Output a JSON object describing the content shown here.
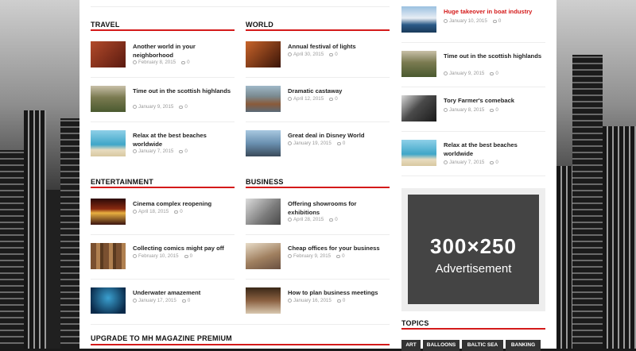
{
  "sections": {
    "travel": {
      "title": "TRAVEL",
      "items": [
        {
          "title": "Another world in your neighborhood",
          "date": "February 8, 2015",
          "comments": "0",
          "thumb_color": "#8a3320"
        },
        {
          "title": "Time out in the scottish highlands",
          "date": "January 9, 2015",
          "comments": "0",
          "thumb_color": "#5b6a3a"
        },
        {
          "title": "Relax at the best beaches worldwide",
          "date": "January 7, 2015",
          "comments": "0",
          "thumb_color": "#3f9fc0"
        }
      ]
    },
    "world": {
      "title": "WORLD",
      "items": [
        {
          "title": "Annual festival of lights",
          "date": "April 30, 2015",
          "comments": "0",
          "thumb_color": "#7a3a1a"
        },
        {
          "title": "Dramatic castaway",
          "date": "April 12, 2015",
          "comments": "0",
          "thumb_color": "#6a7f8f"
        },
        {
          "title": "Great deal in Disney World",
          "date": "January 19, 2015",
          "comments": "0",
          "thumb_color": "#5e86a8"
        }
      ]
    },
    "entertainment": {
      "title": "ENTERTAINMENT",
      "items": [
        {
          "title": "Cinema complex reopening",
          "date": "April 18, 2015",
          "comments": "0",
          "thumb_color": "#3a1410"
        },
        {
          "title": "Collecting comics might pay off",
          "date": "February 10, 2015",
          "comments": "0",
          "thumb_color": "#6b4a2a"
        },
        {
          "title": "Underwater amazement",
          "date": "January 17, 2015",
          "comments": "0",
          "thumb_color": "#0f3a5a"
        }
      ]
    },
    "business": {
      "title": "BUSINESS",
      "items": [
        {
          "title": "Offering showrooms for exhibitions",
          "date": "April 28, 2015",
          "comments": "0",
          "thumb_color": "#8a8a8a"
        },
        {
          "title": "Cheap offices for your business",
          "date": "February 9, 2015",
          "comments": "0",
          "thumb_color": "#9a7a5a"
        },
        {
          "title": "How to plan business meetings",
          "date": "January 16, 2015",
          "comments": "0",
          "thumb_color": "#5a4030"
        }
      ]
    },
    "premium": {
      "title": "UPGRADE TO MH MAGAZINE PREMIUM"
    }
  },
  "sidebar": {
    "posts": [
      {
        "title": "Huge takeover in boat industry",
        "date": "January 10, 2015",
        "comments": "0",
        "thumb_color": "#2c5b88",
        "highlight": true
      },
      {
        "title": "Time out in the scottish highlands",
        "date": "January 9, 2015",
        "comments": "0",
        "thumb_color": "#5b6a3a"
      },
      {
        "title": "Tory Farmer's comeback",
        "date": "January 8, 2015",
        "comments": "0",
        "thumb_color": "#3a3a3a"
      },
      {
        "title": "Relax at the best beaches worldwide",
        "date": "January 7, 2015",
        "comments": "0",
        "thumb_color": "#3f9fc0"
      }
    ],
    "ad": {
      "size": "300×250",
      "label": "Advertisement"
    },
    "topics": {
      "title": "TOPICS",
      "tags": [
        "ART",
        "BALLOONS",
        "BALTIC SEA",
        "BANKING"
      ]
    }
  },
  "colors": {
    "accent": "#d41a1a",
    "text": "#222222",
    "meta": "#999999"
  }
}
